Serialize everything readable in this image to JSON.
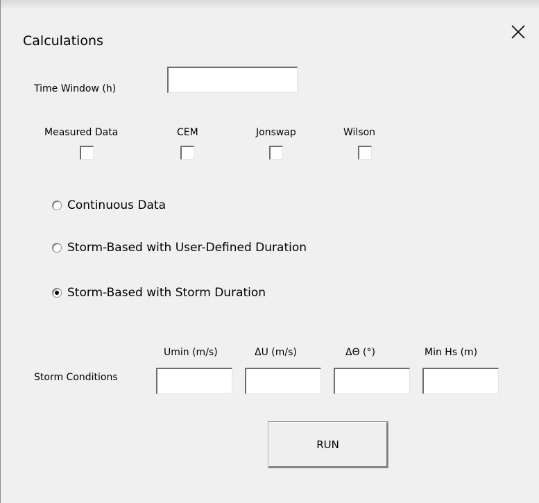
{
  "window": {
    "title": "Calculations"
  },
  "time_window": {
    "label": "Time Window (h)",
    "value": ""
  },
  "methods": [
    {
      "label": "Measured Data",
      "checked": false
    },
    {
      "label": "CEM",
      "checked": false
    },
    {
      "label": "Jonswap",
      "checked": false
    },
    {
      "label": "Wilson",
      "checked": false
    }
  ],
  "analysis_mode": {
    "options": [
      {
        "label": "Continuous Data",
        "selected": false
      },
      {
        "label": "Storm-Based with User-Defined Duration",
        "selected": false
      },
      {
        "label": "Storm-Based with Storm Duration",
        "selected": true
      }
    ]
  },
  "storm_conditions": {
    "label": "Storm Conditions",
    "fields": [
      {
        "label": "Umin (m/s)",
        "value": ""
      },
      {
        "label": "ΔU (m/s)",
        "value": ""
      },
      {
        "label": "ΔΘ (°)",
        "value": ""
      },
      {
        "label": "Min Hs (m)",
        "value": ""
      }
    ]
  },
  "run_button": {
    "label": "RUN"
  },
  "icons": {
    "close": "close-icon",
    "radio": "radio-button",
    "checkbox": "checkbox"
  }
}
